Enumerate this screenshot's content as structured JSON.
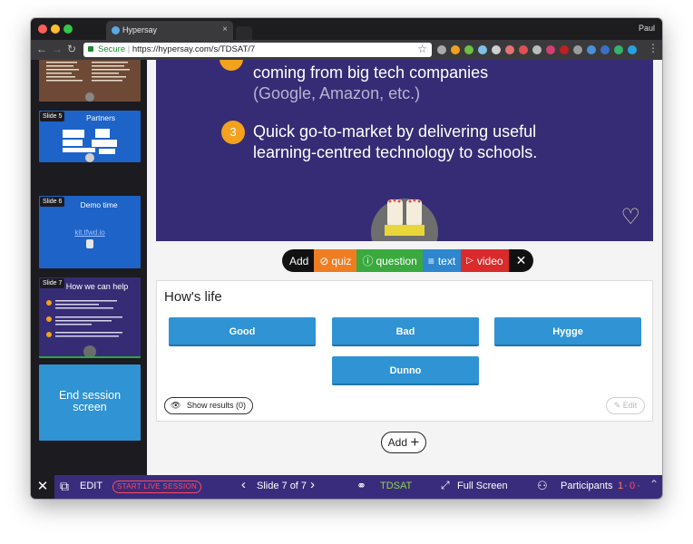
{
  "browser": {
    "tab_title": "Hypersay",
    "user_name": "Paul",
    "secure_label": "Secure",
    "url": "https://hypersay.com/s/TDSAT/7",
    "colors": {
      "close": "#fc5f57",
      "minimize": "#fdbc2e",
      "zoom": "#33c748"
    },
    "icons": [
      "back-icon",
      "forward-icon",
      "reload-icon",
      "lock-icon",
      "star-icon",
      "close-icon"
    ]
  },
  "sidebar": {
    "slides": [
      {
        "num": "",
        "title": ""
      },
      {
        "num": "Slide 5",
        "title": "Partners"
      },
      {
        "num": "Slide 6",
        "title": "Demo time",
        "link": "kit.tfwd.io"
      },
      {
        "num": "Slide 7",
        "title": "How we can help"
      },
      {
        "num": "",
        "title": "End session screen"
      }
    ],
    "end_session_label": "End session screen"
  },
  "slide": {
    "line1": "coming from big tech companies",
    "line2": "(Google, Amazon, etc.)",
    "item_number": "3",
    "line3": "Quick go-to-market by delivering useful",
    "line4": "learning-centred technology to schools.",
    "heart_icon": "heart-icon"
  },
  "add_toolbar": {
    "add_label": "Add",
    "quiz_label": "quiz",
    "question_label": "question",
    "text_label": "text",
    "video_label": "video",
    "colors": {
      "quiz": "#ef7d22",
      "question": "#3aa93e",
      "text": "#2e86cf",
      "video": "#d92b2b"
    }
  },
  "quiz": {
    "title": "How's life",
    "options": [
      "Good",
      "Bad",
      "Hygge",
      "Dunno"
    ],
    "show_results_label": "Show results (0)",
    "edit_label": "Edit"
  },
  "add_button_label": "Add",
  "bottom_bar": {
    "edit_label": "EDIT",
    "live_label": "START LIVE SESSION",
    "slide_indicator": "Slide 7 of 7",
    "session_code": "TDSAT",
    "fullscreen_label": "Full Screen",
    "participants_label": "Participants",
    "count_a": "1",
    "count_b": "0",
    "colors": {
      "bar": "#3a2c7c",
      "code": "#8fd14f",
      "live": "#ff4a5c"
    }
  }
}
